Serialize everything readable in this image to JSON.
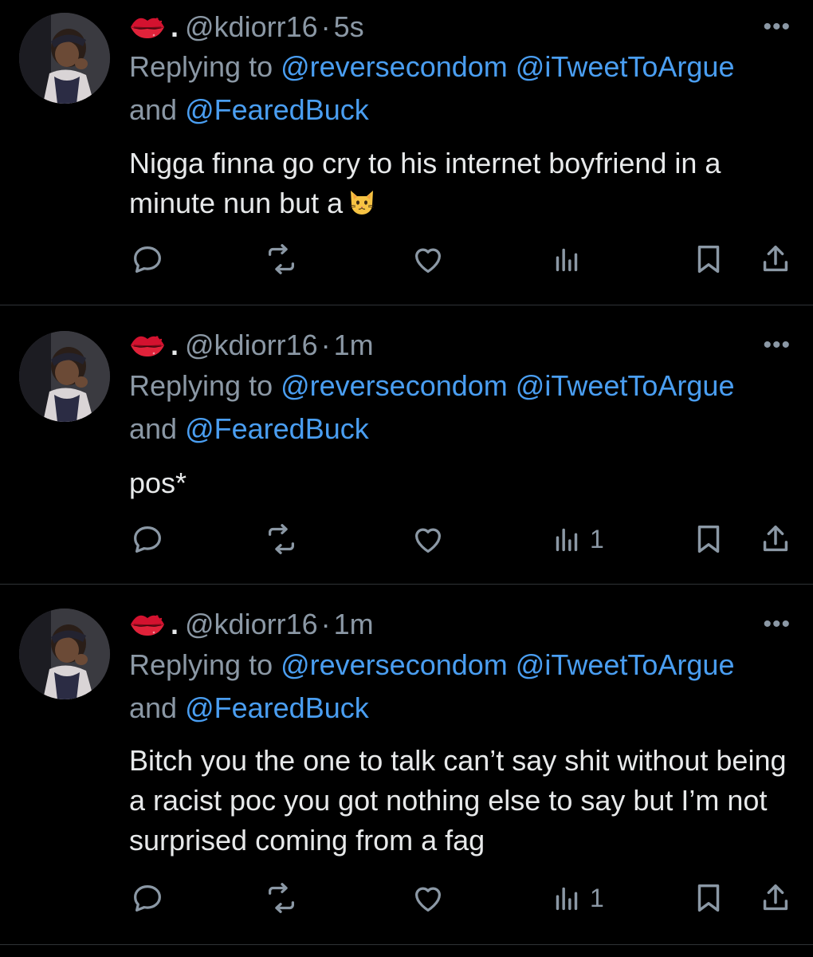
{
  "tweets": [
    {
      "handle": "@kdiorr16",
      "sep": "·",
      "time": "5s",
      "reply_prefix": "Replying to ",
      "mention1": "@reversecondom",
      "mention2": "@iTweetToArgue",
      "reply_and": "and ",
      "mention3": "@FearedBuck",
      "text": "Nigga finna go cry to his internet boyfriend in a minute nun but a",
      "emoji": "cat-face-icon",
      "views": ""
    },
    {
      "handle": "@kdiorr16",
      "sep": "·",
      "time": "1m",
      "reply_prefix": "Replying to ",
      "mention1": "@reversecondom",
      "mention2": "@iTweetToArgue",
      "reply_and": "and ",
      "mention3": "@FearedBuck",
      "text": "pos*",
      "views": "1"
    },
    {
      "handle": "@kdiorr16",
      "sep": "·",
      "time": "1m",
      "reply_prefix": "Replying to ",
      "mention1": "@reversecondom",
      "mention2": "@iTweetToArgue",
      "reply_and": "and ",
      "mention3": "@FearedBuck",
      "text": "Bitch you the one to talk can’t say shit without being a racist poc you got nothing else to say but I’m not surprised coming from a fag",
      "views": "1"
    }
  ],
  "name_suffix": ".",
  "more_label": "•••",
  "colors": {
    "background": "#000000",
    "text": "#e7e9ea",
    "muted": "#8b98a5",
    "link": "#4a9ef1",
    "lips": "#d3122f"
  },
  "icons": [
    "lips-kiss-icon",
    "more-icon",
    "reply-icon",
    "retweet-icon",
    "like-icon",
    "views-icon",
    "bookmark-icon",
    "share-icon"
  ]
}
